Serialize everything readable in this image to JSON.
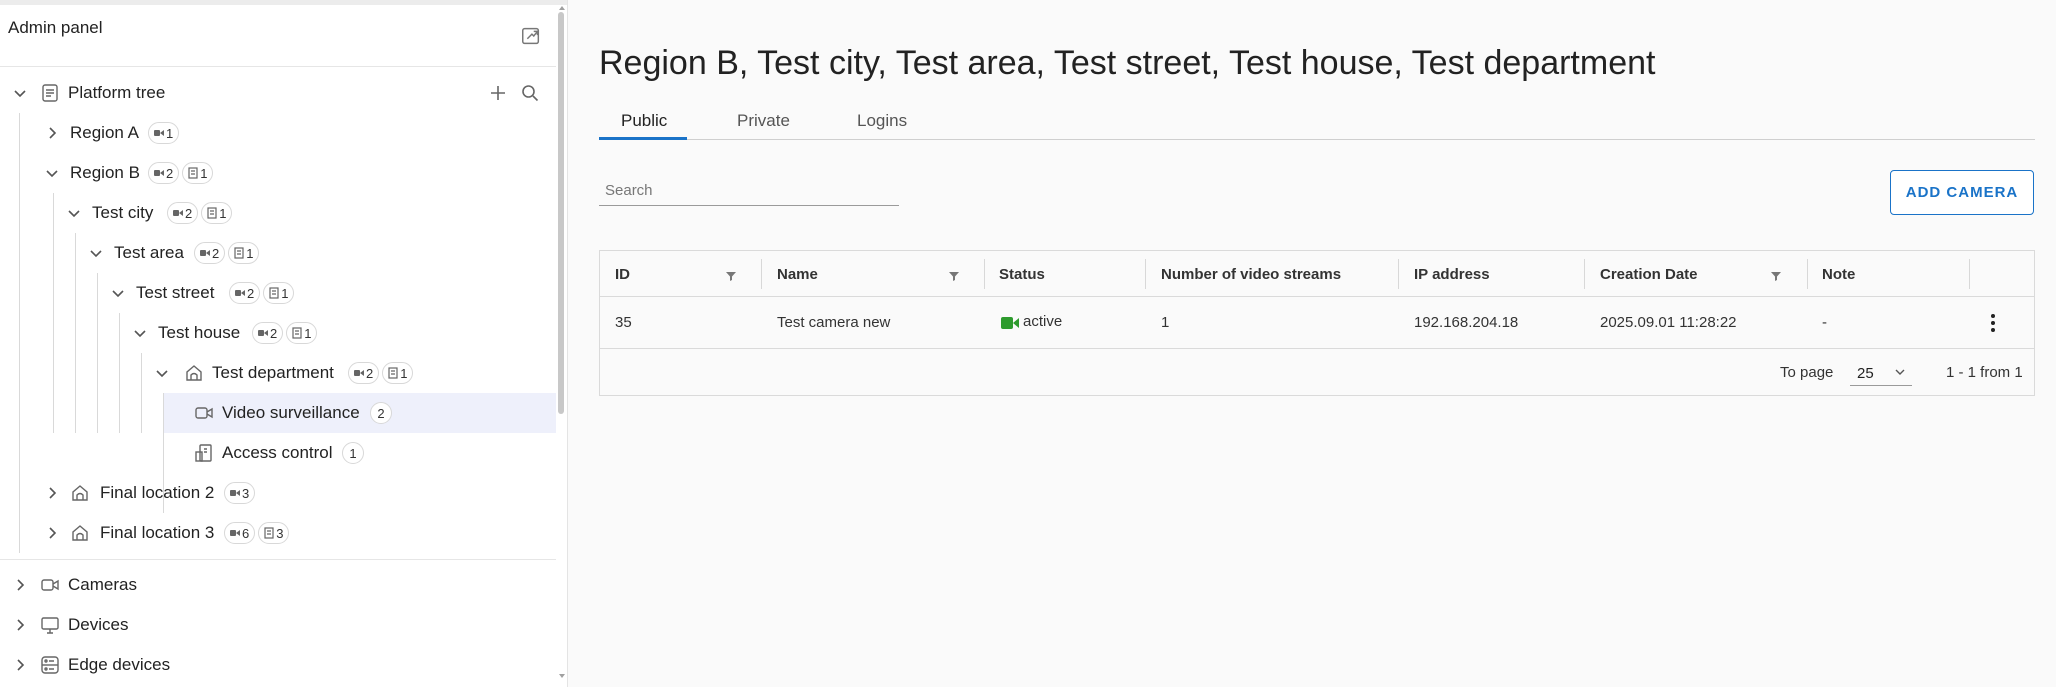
{
  "sidebar": {
    "title": "Admin panel",
    "tree": {
      "root_label": "Platform tree",
      "nodes": [
        {
          "label": "Region A",
          "cams": "1"
        },
        {
          "label": "Region B",
          "cams": "2",
          "access": "1"
        },
        {
          "label": "Test city",
          "cams": "2",
          "access": "1"
        },
        {
          "label": "Test area",
          "cams": "2",
          "access": "1"
        },
        {
          "label": "Test street",
          "cams": "2",
          "access": "1"
        },
        {
          "label": "Test house",
          "cams": "2",
          "access": "1"
        },
        {
          "label": "Test department",
          "cams": "2",
          "access": "1"
        },
        {
          "label": "Video surveillance",
          "count": "2"
        },
        {
          "label": "Access control",
          "count": "1"
        },
        {
          "label": "Final location 2",
          "cams": "3"
        },
        {
          "label": "Final location 3",
          "cams": "6",
          "access": "3"
        }
      ]
    },
    "sections": [
      {
        "label": "Cameras"
      },
      {
        "label": "Devices"
      },
      {
        "label": "Edge devices"
      }
    ]
  },
  "main": {
    "title": "Region B, Test city, Test area, Test street, Test house, Test department",
    "tabs": [
      {
        "label": "Public"
      },
      {
        "label": "Private"
      },
      {
        "label": "Logins"
      }
    ],
    "active_tab": "Public",
    "search": {
      "placeholder": "Search",
      "value": ""
    },
    "add_button": "ADD CAMERA",
    "table": {
      "columns": [
        "ID",
        "Name",
        "Status",
        "Number of video streams",
        "IP address",
        "Creation Date",
        "Note"
      ],
      "rows": [
        {
          "id": "35",
          "name": "Test camera new",
          "status": "active",
          "streams": "1",
          "ip": "192.168.204.18",
          "created": "2025.09.01 11:28:22",
          "note": "-"
        }
      ],
      "footer": {
        "per_page_label": "To page",
        "per_page_value": "25",
        "range": "1 - 1 from 1"
      }
    }
  },
  "colors": {
    "accent": "#1a73c8",
    "status_active": "#2e9b2e",
    "selected_row": "#eef0fb"
  }
}
